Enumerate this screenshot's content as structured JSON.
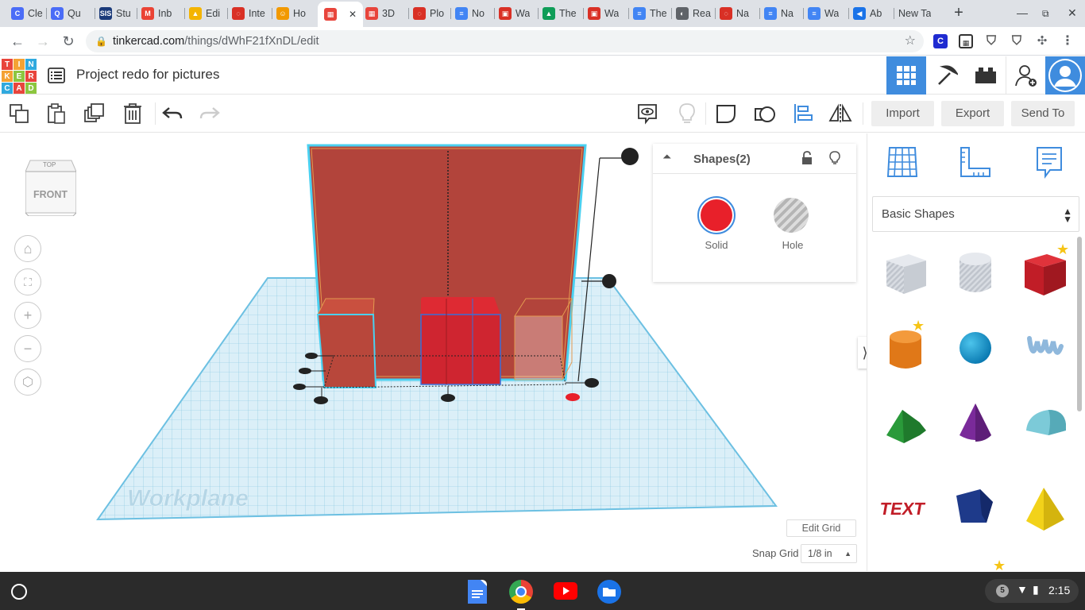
{
  "browser": {
    "tabs": [
      {
        "label": "Cle",
        "favicon": "C",
        "color": "#4a6cf7"
      },
      {
        "label": "Qu",
        "favicon": "Q",
        "color": "#4a6cf7"
      },
      {
        "label": "Stu",
        "favicon": "SIS",
        "color": "#1b3a7a"
      },
      {
        "label": "Inb",
        "favicon": "M",
        "color": "#ea4335"
      },
      {
        "label": "Edi",
        "favicon": "▲",
        "color": "#f4b400"
      },
      {
        "label": "Inte",
        "favicon": "◌",
        "color": "#d93025"
      },
      {
        "label": "Ho",
        "favicon": "☺",
        "color": "#f29900"
      },
      {
        "label": "",
        "favicon": "▦",
        "color": "#e8453c"
      },
      {
        "label": "3D",
        "favicon": "▦",
        "color": "#e8453c"
      },
      {
        "label": "Plo",
        "favicon": "◌",
        "color": "#d93025"
      },
      {
        "label": "No",
        "favicon": "≡",
        "color": "#4285f4"
      },
      {
        "label": "Wa",
        "favicon": "▣",
        "color": "#d93025"
      },
      {
        "label": "The",
        "favicon": "▲",
        "color": "#0f9d58"
      },
      {
        "label": "Wa",
        "favicon": "▣",
        "color": "#d93025"
      },
      {
        "label": "The",
        "favicon": "≡",
        "color": "#4285f4"
      },
      {
        "label": "Rea",
        "favicon": "◐",
        "color": "#5f6368"
      },
      {
        "label": "Na",
        "favicon": "◌",
        "color": "#d93025"
      },
      {
        "label": "Na",
        "favicon": "≡",
        "color": "#4285f4"
      },
      {
        "label": "Wa",
        "favicon": "≡",
        "color": "#4285f4"
      },
      {
        "label": "Ab",
        "favicon": "◀",
        "color": "#1a73e8"
      },
      {
        "label": "New Ta",
        "favicon": "",
        "color": "#dee1e6"
      }
    ],
    "url_host": "tinkercad.com",
    "url_path": "/things/dWhF21fXnDL/edit"
  },
  "app": {
    "logo_letters": [
      "T",
      "I",
      "N",
      "K",
      "E",
      "R",
      "C",
      "A",
      "D"
    ],
    "project_title": "Project redo for pictures"
  },
  "toolbar": {
    "import_label": "Import",
    "export_label": "Export",
    "send_to_label": "Send To"
  },
  "viewcube": {
    "top_label": "TOP",
    "front_label": "FRONT"
  },
  "inspector": {
    "title": "Shapes(2)",
    "solid_label": "Solid",
    "hole_label": "Hole",
    "solid_color": "#e8202a"
  },
  "workplane_label": "Workplane",
  "edit_grid_label": "Edit Grid",
  "snap_grid_label": "Snap Grid",
  "snap_grid_value": "1/8 in",
  "library": {
    "selected": "Basic Shapes",
    "shapes": [
      "box-hole",
      "cylinder-hole",
      "box",
      "cylinder",
      "sphere",
      "scribble",
      "roof",
      "cone",
      "round-roof",
      "text",
      "polygon",
      "pyramid"
    ]
  },
  "taskbar": {
    "notifications": "5",
    "time": "2:15"
  }
}
